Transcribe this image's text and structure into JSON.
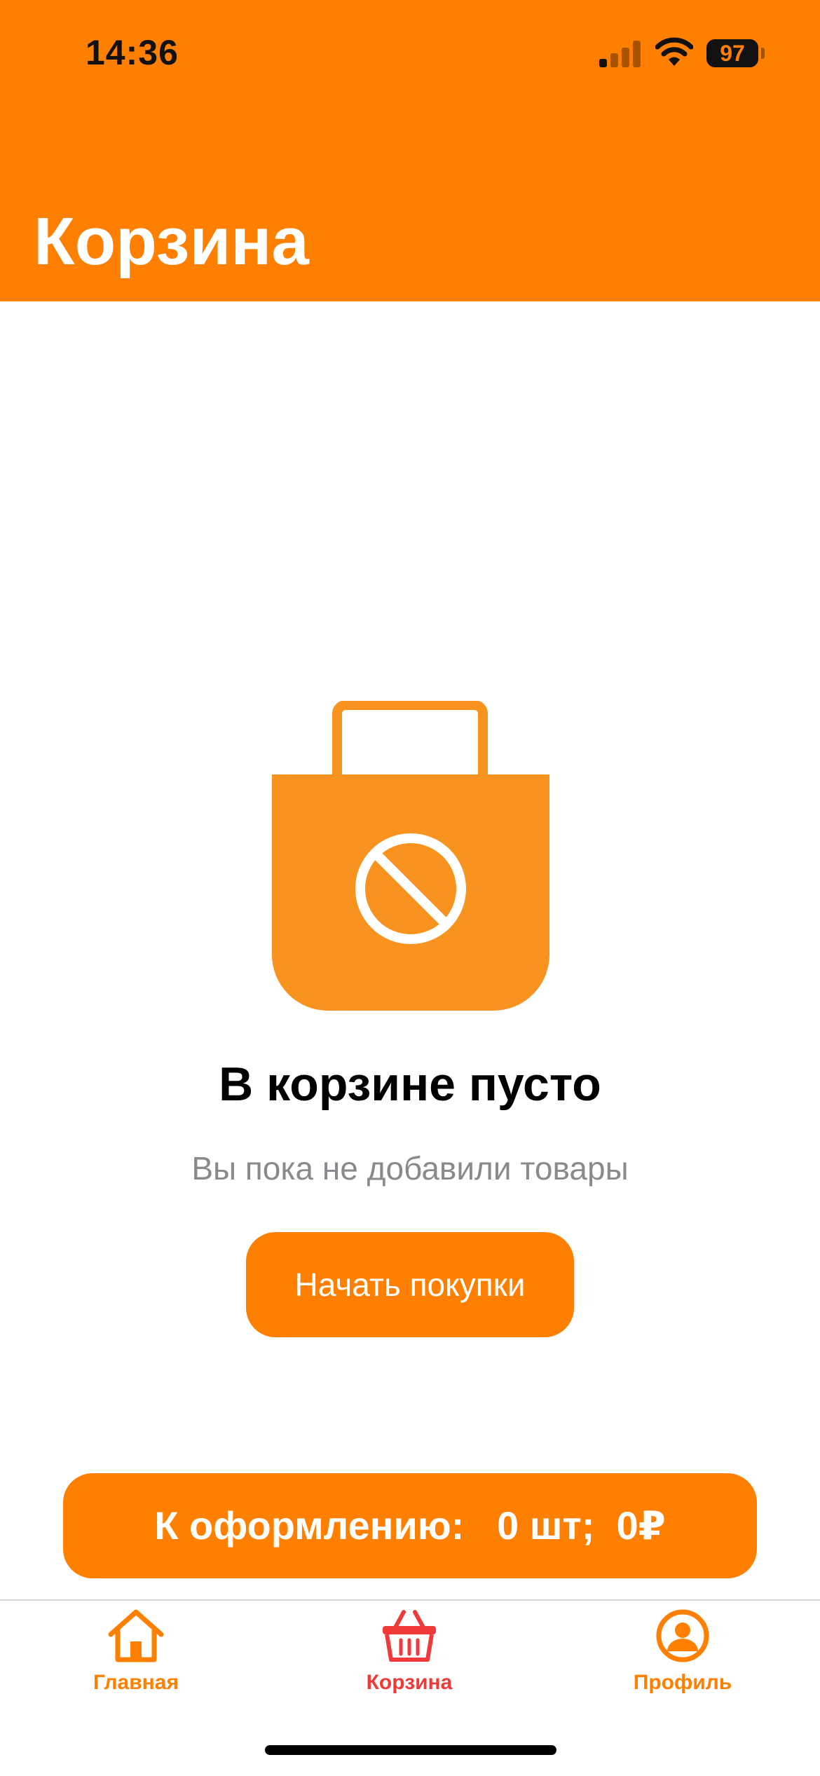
{
  "status_bar": {
    "time": "14:36",
    "battery": "97"
  },
  "header": {
    "title": "Корзина"
  },
  "empty_state": {
    "icon": "empty-bag-icon",
    "title": "В корзине пусто",
    "subtitle": "Вы пока не добавили товары",
    "button_label": "Начать покупки"
  },
  "checkout": {
    "label": "К оформлению:   0 шт;  0₽"
  },
  "tabbar": {
    "items": [
      {
        "label": "Главная",
        "icon": "home-icon",
        "color": "#FF8000"
      },
      {
        "label": "Корзина",
        "icon": "basket-icon",
        "color": "#F03A3A",
        "active": true
      },
      {
        "label": "Профиль",
        "icon": "profile-icon",
        "color": "#FF8000"
      }
    ]
  },
  "colors": {
    "accent": "#FF8000",
    "icon": "#F7931E",
    "active_tab": "#F03A3A"
  }
}
